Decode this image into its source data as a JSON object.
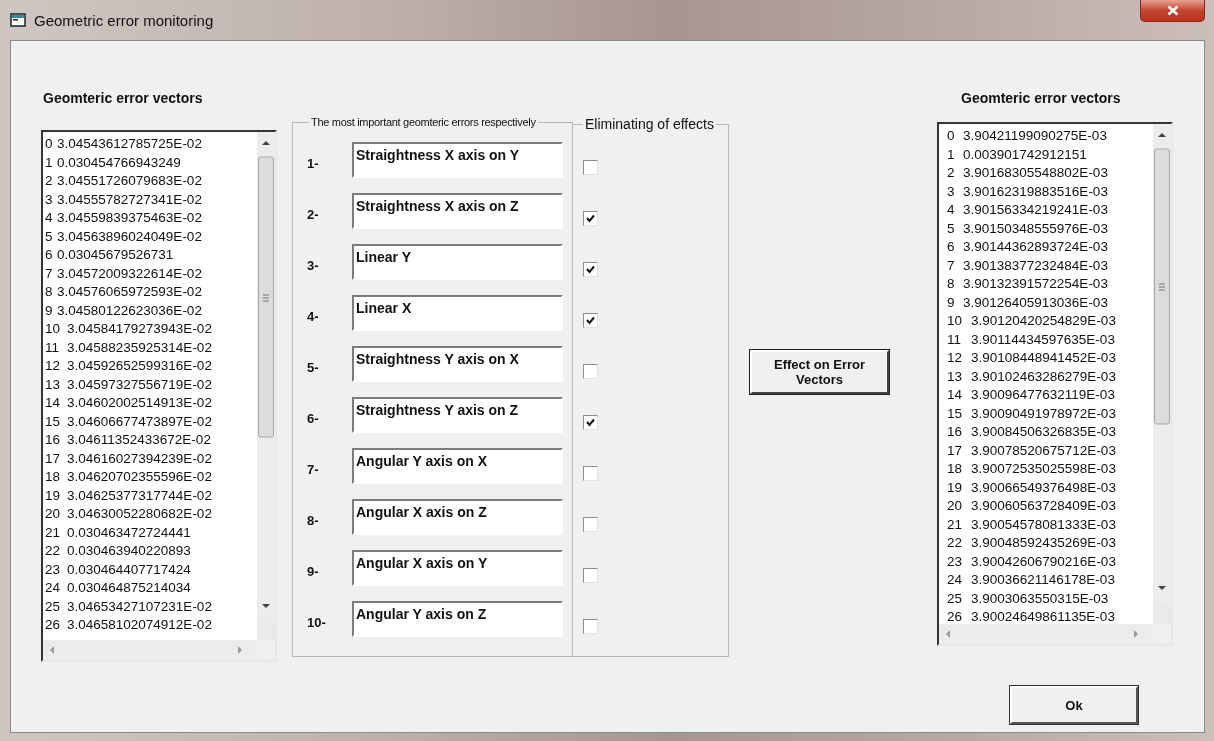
{
  "window": {
    "title": "Geometric error monitoring"
  },
  "left_list": {
    "heading": "Geomteric error vectors",
    "rows": [
      {
        "index": "0",
        "value": "3.04543612785725E-02"
      },
      {
        "index": "1",
        "value": "0.030454766943249"
      },
      {
        "index": "2",
        "value": "3.04551726079683E-02"
      },
      {
        "index": "3",
        "value": "3.04555782727341E-02"
      },
      {
        "index": "4",
        "value": "3.04559839375463E-02"
      },
      {
        "index": "5",
        "value": "3.04563896024049E-02"
      },
      {
        "index": "6",
        "value": "0.03045679526731"
      },
      {
        "index": "7",
        "value": "3.04572009322614E-02"
      },
      {
        "index": "8",
        "value": "3.04576065972593E-02"
      },
      {
        "index": "9",
        "value": "3.04580122623036E-02"
      },
      {
        "index": "10",
        "value": "3.04584179273943E-02"
      },
      {
        "index": "11",
        "value": "3.04588235925314E-02"
      },
      {
        "index": "12",
        "value": "3.04592652599316E-02"
      },
      {
        "index": "13",
        "value": "3.04597327556719E-02"
      },
      {
        "index": "14",
        "value": "3.04602002514913E-02"
      },
      {
        "index": "15",
        "value": "3.04606677473897E-02"
      },
      {
        "index": "16",
        "value": "3.04611352433672E-02"
      },
      {
        "index": "17",
        "value": "3.04616027394239E-02"
      },
      {
        "index": "18",
        "value": "3.04620702355596E-02"
      },
      {
        "index": "19",
        "value": "3.04625377317744E-02"
      },
      {
        "index": "20",
        "value": "3.04630052280682E-02"
      },
      {
        "index": "21",
        "value": "0.030463472724441"
      },
      {
        "index": "22",
        "value": "0.030463940220893"
      },
      {
        "index": "23",
        "value": "0.030464407717424"
      },
      {
        "index": "24",
        "value": "0.030464875214034"
      },
      {
        "index": "25",
        "value": "3.04653427107231E-02"
      },
      {
        "index": "26",
        "value": "3.04658102074912E-02"
      }
    ]
  },
  "errors_group": {
    "title": "The most important geomteric errors respectively",
    "items": [
      {
        "number": "1-",
        "name": "Straightness X axis on Y"
      },
      {
        "number": "2-",
        "name": "Straightness X axis on Z"
      },
      {
        "number": "3-",
        "name": "Linear Y"
      },
      {
        "number": "4-",
        "name": "Linear X"
      },
      {
        "number": "5-",
        "name": "Straightness Y axis on X"
      },
      {
        "number": "6-",
        "name": "Straightness Y axis on Z"
      },
      {
        "number": "7-",
        "name": "Angular Y axis on X"
      },
      {
        "number": "8-",
        "name": "Angular X axis on Z"
      },
      {
        "number": "9-",
        "name": "Angular X axis on Y"
      },
      {
        "number": "10-",
        "name": "Angular Y axis on Z"
      }
    ]
  },
  "eliminating_group": {
    "title": "Eliminating of effects",
    "checks": [
      {
        "checked": false
      },
      {
        "checked": true
      },
      {
        "checked": true
      },
      {
        "checked": true
      },
      {
        "checked": false
      },
      {
        "checked": true
      },
      {
        "checked": false
      },
      {
        "checked": false
      },
      {
        "checked": false
      },
      {
        "checked": false
      }
    ]
  },
  "effect_button": {
    "label": "Effect on Error Vectors"
  },
  "right_list": {
    "heading": "Geomteric error vectors",
    "rows": [
      {
        "index": "0",
        "value": "3.90421199090275E-03"
      },
      {
        "index": "1",
        "value": "0.003901742912151"
      },
      {
        "index": "2",
        "value": "3.90168305548802E-03"
      },
      {
        "index": "3",
        "value": "3.90162319883516E-03"
      },
      {
        "index": "4",
        "value": "3.90156334219241E-03"
      },
      {
        "index": "5",
        "value": "3.90150348555976E-03"
      },
      {
        "index": "6",
        "value": "3.90144362893724E-03"
      },
      {
        "index": "7",
        "value": "3.90138377232484E-03"
      },
      {
        "index": "8",
        "value": "3.90132391572254E-03"
      },
      {
        "index": "9",
        "value": "3.90126405913036E-03"
      },
      {
        "index": "10",
        "value": "3.90120420254829E-03"
      },
      {
        "index": "11",
        "value": "3.90114434597635E-03"
      },
      {
        "index": "12",
        "value": "3.90108448941452E-03"
      },
      {
        "index": "13",
        "value": "3.90102463286279E-03"
      },
      {
        "index": "14",
        "value": "3.90096477632119E-03"
      },
      {
        "index": "15",
        "value": "3.90090491978972E-03"
      },
      {
        "index": "16",
        "value": "3.90084506326835E-03"
      },
      {
        "index": "17",
        "value": "3.90078520675712E-03"
      },
      {
        "index": "18",
        "value": "3.90072535025598E-03"
      },
      {
        "index": "19",
        "value": "3.90066549376498E-03"
      },
      {
        "index": "20",
        "value": "3.90060563728409E-03"
      },
      {
        "index": "21",
        "value": "3.90054578081333E-03"
      },
      {
        "index": "22",
        "value": "3.90048592435269E-03"
      },
      {
        "index": "23",
        "value": "3.90042606790216E-03"
      },
      {
        "index": "24",
        "value": "3.90036621146178E-03"
      },
      {
        "index": "25",
        "value": "3.9003063550315E-03"
      },
      {
        "index": "26",
        "value": "3.90024649861135E-03"
      }
    ]
  },
  "ok_button": {
    "label": "Ok"
  }
}
